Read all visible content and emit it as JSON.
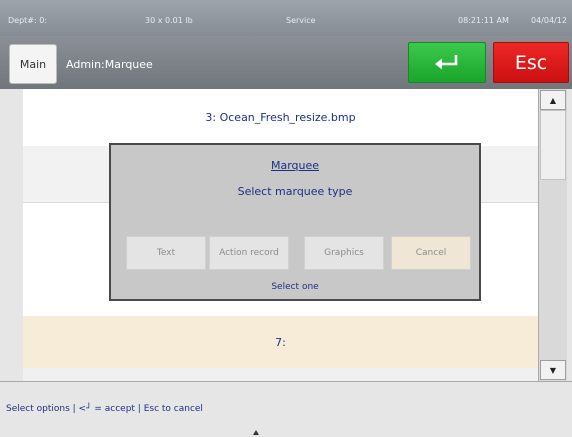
{
  "statusbar": {
    "dept": "Dept#: 0:",
    "weight": "30 x 0.01 lb",
    "mode": "Service",
    "time": "08:21:11 AM",
    "date": "04/04/12"
  },
  "header": {
    "main_label": "Main",
    "breadcrumb": "Admin:Marquee",
    "esc_label": "Esc",
    "enter_icon": "enter-arrow-icon",
    "enter_color": "#22b233",
    "esc_color": "#dd1a1a"
  },
  "list": {
    "rows": [
      {
        "label": "3: Ocean_Fresh_resize.bmp"
      },
      {
        "label": ""
      },
      {
        "label": "7:"
      }
    ]
  },
  "dialog": {
    "title": "Marquee",
    "message": "Select marquee type",
    "buttons": [
      {
        "label": "Text"
      },
      {
        "label": "Action record"
      },
      {
        "label": "Graphics"
      },
      {
        "label": "Cancel"
      }
    ],
    "hint": "Select one"
  },
  "footer": {
    "status_text": "Select options | <┘ = accept | Esc to cancel"
  }
}
